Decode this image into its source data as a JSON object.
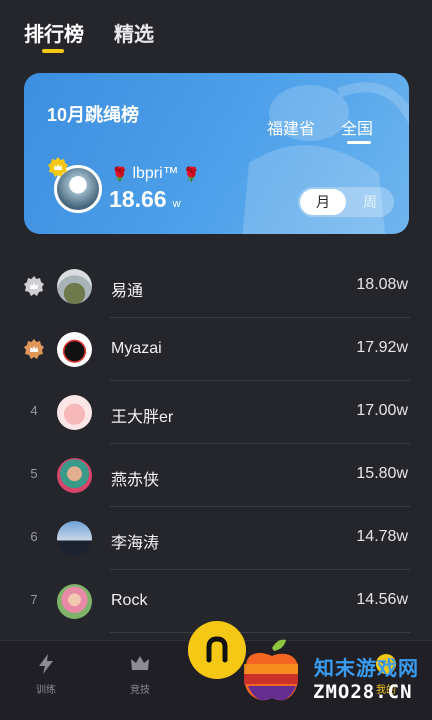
{
  "top_tabs": [
    {
      "label": "排行榜",
      "active": true
    },
    {
      "label": "精选",
      "active": false
    }
  ],
  "banner": {
    "title": "10月跳绳榜",
    "region_tabs": [
      {
        "label": "福建省",
        "active": false
      },
      {
        "label": "全国",
        "active": true
      }
    ],
    "leader": {
      "name": "lbpri™",
      "name_prefix": "🌹",
      "name_suffix": "🌹",
      "score": "18.66",
      "unit": "w"
    },
    "period": {
      "month": "月",
      "week": "周",
      "selected": "月"
    }
  },
  "ranking": [
    {
      "rank": "1",
      "name": "易通",
      "score": "18.08w",
      "medal": "silver",
      "avatar": "grass-field"
    },
    {
      "rank": "2",
      "name": "Myazai",
      "score": "17.92w",
      "medal": "bronze",
      "avatar": "black-cat"
    },
    {
      "rank": "4",
      "name": "王大胖er",
      "score": "17.00w",
      "medal": "",
      "avatar": "cartoon-pig"
    },
    {
      "rank": "5",
      "name": "燕赤侠",
      "score": "15.80w",
      "medal": "",
      "avatar": "colorful-portrait"
    },
    {
      "rank": "6",
      "name": "李海涛",
      "score": "14.78w",
      "medal": "",
      "avatar": "sunset-silhouette"
    },
    {
      "rank": "7",
      "name": "Rock",
      "score": "14.56w",
      "medal": "",
      "avatar": "girl-outdoors"
    }
  ],
  "bottom_nav": [
    {
      "label": "训练",
      "icon": "lightning-icon",
      "active": false
    },
    {
      "label": "竞技",
      "icon": "crown-icon",
      "active": false
    },
    {
      "label": "我的",
      "icon": "user-icon",
      "active": true
    }
  ],
  "watermark": {
    "line1": "知末游戏网",
    "line2": "ZMO28.CN"
  },
  "colors": {
    "background": "#25252c",
    "accent": "#f5c815",
    "banner_blue": "#4a9be8",
    "silver_medal": "#cfcfd4",
    "bronze_medal": "#e0985a"
  }
}
